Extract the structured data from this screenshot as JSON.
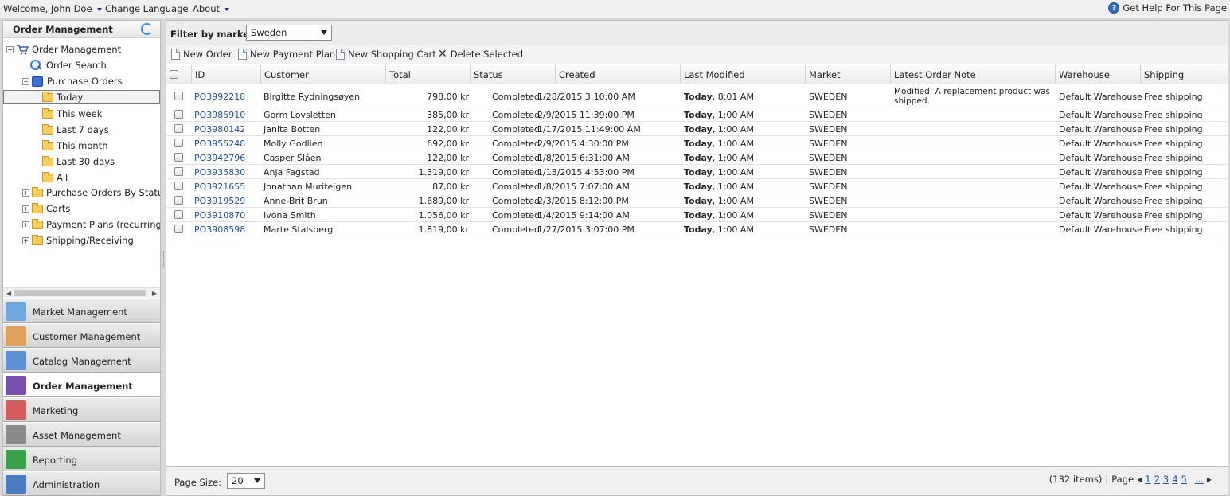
{
  "topbar": {
    "welcome": "Welcome, John Doe",
    "change_language": "Change Language",
    "about": "About",
    "help": "Get Help For This Page"
  },
  "left_panel": {
    "title": "Order Management",
    "tree": [
      {
        "label": "Order Management"
      },
      {
        "label": "Order Search"
      },
      {
        "label": "Purchase Orders"
      },
      {
        "label": "Today"
      },
      {
        "label": "This week"
      },
      {
        "label": "Last 7 days"
      },
      {
        "label": "This month"
      },
      {
        "label": "Last 30 days"
      },
      {
        "label": "All"
      },
      {
        "label": "Purchase Orders By Status"
      },
      {
        "label": "Carts"
      },
      {
        "label": "Payment Plans (recurring)"
      },
      {
        "label": "Shipping/Receiving"
      }
    ],
    "modules": [
      {
        "label": "Market Management",
        "color": "#6fa8dc"
      },
      {
        "label": "Customer Management",
        "color": "#e0a15c"
      },
      {
        "label": "Catalog Management",
        "color": "#5b8fd6"
      },
      {
        "label": "Order Management",
        "color": "#7a4fb0"
      },
      {
        "label": "Marketing",
        "color": "#d65b5b"
      },
      {
        "label": "Asset Management",
        "color": "#8a8a8a"
      },
      {
        "label": "Reporting",
        "color": "#3aa04a"
      },
      {
        "label": "Administration",
        "color": "#4a7cc4"
      }
    ]
  },
  "filter": {
    "label": "Filter by market:",
    "value": "Sweden"
  },
  "toolbar": {
    "new_order": "New Order",
    "new_payment_plan": "New Payment Plan",
    "new_shopping_cart": "New Shopping Cart",
    "delete_selected": "Delete Selected"
  },
  "grid": {
    "headers": [
      "ID",
      "Customer",
      "Total",
      "Status",
      "Created",
      "Last Modified",
      "Market",
      "Latest Order Note",
      "Warehouse",
      "Shipping"
    ],
    "rows": [
      {
        "id": "PO3992218",
        "customer": "Birgitte Rydningsøyen",
        "total": "798,00 kr",
        "status": "Completed",
        "created": "1/28/2015 3:10:00 AM",
        "mod_day": "Today",
        "mod_time": ", 8:01 AM",
        "market": "SWEDEN",
        "note": "Modified: A replacement product was shipped.",
        "warehouse": "Default Warehouse",
        "shipping": "Free shipping"
      },
      {
        "id": "PO3985910",
        "customer": "Gorm Lovsletten",
        "total": "385,00 kr",
        "status": "Completed",
        "created": "2/9/2015 11:39:00 PM",
        "mod_day": "Today",
        "mod_time": ", 1:00 AM",
        "market": "SWEDEN",
        "note": "",
        "warehouse": "Default Warehouse",
        "shipping": "Free shipping"
      },
      {
        "id": "PO3980142",
        "customer": "Janita Botten",
        "total": "122,00 kr",
        "status": "Completed",
        "created": "1/17/2015 11:49:00 AM",
        "mod_day": "Today",
        "mod_time": ", 1:00 AM",
        "market": "SWEDEN",
        "note": "",
        "warehouse": "Default Warehouse",
        "shipping": "Free shipping"
      },
      {
        "id": "PO3955248",
        "customer": "Molly Godlien",
        "total": "692,00 kr",
        "status": "Completed",
        "created": "2/9/2015 4:30:00 PM",
        "mod_day": "Today",
        "mod_time": ", 1:00 AM",
        "market": "SWEDEN",
        "note": "",
        "warehouse": "Default Warehouse",
        "shipping": "Free shipping"
      },
      {
        "id": "PO3942796",
        "customer": "Casper Slåen",
        "total": "122,00 kr",
        "status": "Completed",
        "created": "1/8/2015 6:31:00 AM",
        "mod_day": "Today",
        "mod_time": ", 1:00 AM",
        "market": "SWEDEN",
        "note": "",
        "warehouse": "Default Warehouse",
        "shipping": "Free shipping"
      },
      {
        "id": "PO3935830",
        "customer": "Anja Fagstad",
        "total": "1.319,00 kr",
        "status": "Completed",
        "created": "1/13/2015 4:53:00 PM",
        "mod_day": "Today",
        "mod_time": ", 1:00 AM",
        "market": "SWEDEN",
        "note": "",
        "warehouse": "Default Warehouse",
        "shipping": "Free shipping"
      },
      {
        "id": "PO3921655",
        "customer": "Jonathan Muriteigen",
        "total": "87,00 kr",
        "status": "Completed",
        "created": "1/8/2015 7:07:00 AM",
        "mod_day": "Today",
        "mod_time": ", 1:00 AM",
        "market": "SWEDEN",
        "note": "",
        "warehouse": "Default Warehouse",
        "shipping": "Free shipping"
      },
      {
        "id": "PO3919529",
        "customer": "Anne-Brit Brun",
        "total": "1.689,00 kr",
        "status": "Completed",
        "created": "2/3/2015 8:12:00 PM",
        "mod_day": "Today",
        "mod_time": ", 1:00 AM",
        "market": "SWEDEN",
        "note": "",
        "warehouse": "Default Warehouse",
        "shipping": "Free shipping"
      },
      {
        "id": "PO3910870",
        "customer": "Ivona Smith",
        "total": "1.056,00 kr",
        "status": "Completed",
        "created": "1/4/2015 9:14:00 AM",
        "mod_day": "Today",
        "mod_time": ", 1:00 AM",
        "market": "SWEDEN",
        "note": "",
        "warehouse": "Default Warehouse",
        "shipping": "Free shipping"
      },
      {
        "id": "PO3908598",
        "customer": "Marte Stalsberg",
        "total": "1.819,00 kr",
        "status": "Completed",
        "created": "1/27/2015 3:07:00 PM",
        "mod_day": "Today",
        "mod_time": ", 1:00 AM",
        "market": "SWEDEN",
        "note": "",
        "warehouse": "Default Warehouse",
        "shipping": "Free shipping"
      }
    ]
  },
  "pager": {
    "page_size_label": "Page Size:",
    "page_size": "20",
    "items_info": "(132 items)",
    "sep": "|",
    "page_label": "Page",
    "pages": [
      "1",
      "2",
      "3",
      "4",
      "5"
    ],
    "more": "..."
  }
}
